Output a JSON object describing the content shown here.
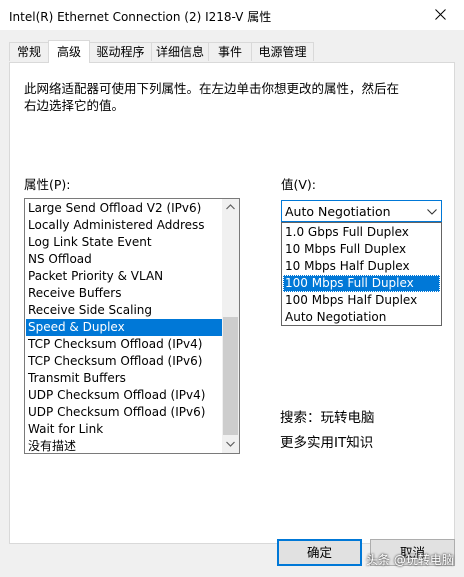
{
  "window": {
    "title": "Intel(R) Ethernet Connection (2) I218-V 属性"
  },
  "tabs": [
    {
      "label": "常规"
    },
    {
      "label": "高级"
    },
    {
      "label": "驱动程序"
    },
    {
      "label": "详细信息"
    },
    {
      "label": "事件"
    },
    {
      "label": "电源管理"
    }
  ],
  "active_tab": "高级",
  "description": "此网络适配器可使用下列属性。在左边单击你想更改的属性，然后在右边选择它的值。",
  "properties": {
    "label": "属性(P):",
    "items": [
      "Large Send Offload V2 (IPv6)",
      "Locally Administered Address",
      "Log Link State Event",
      "NS Offload",
      "Packet Priority & VLAN",
      "Receive Buffers",
      "Receive Side Scaling",
      "Speed & Duplex",
      "TCP Checksum Offload (IPv4)",
      "TCP Checksum Offload (IPv6)",
      "Transmit Buffers",
      "UDP Checksum Offload (IPv4)",
      "UDP Checksum Offload (IPv6)",
      "Wait for Link",
      "没有描述"
    ],
    "selected": "Speed & Duplex"
  },
  "value": {
    "label": "值(V):",
    "current": "Auto Negotiation",
    "options": [
      "1.0 Gbps Full Duplex",
      "10 Mbps Full Duplex",
      "10 Mbps Half Duplex",
      "100 Mbps Full Duplex",
      "100 Mbps Half Duplex",
      "Auto Negotiation"
    ],
    "highlighted": "100 Mbps Full Duplex"
  },
  "overlay_text": {
    "line1": "搜索：玩转电脑",
    "line2": "更多实用IT知识"
  },
  "buttons": {
    "ok": "确定",
    "cancel": "取消"
  },
  "corner_watermark": "头条 @玩转电脑",
  "colors": {
    "accent": "#0078d7",
    "panel_bg": "#ffffff",
    "dialog_bg": "#f0f0f0"
  },
  "icons": {
    "close": "close-icon",
    "combo": "chevron-down-icon"
  }
}
